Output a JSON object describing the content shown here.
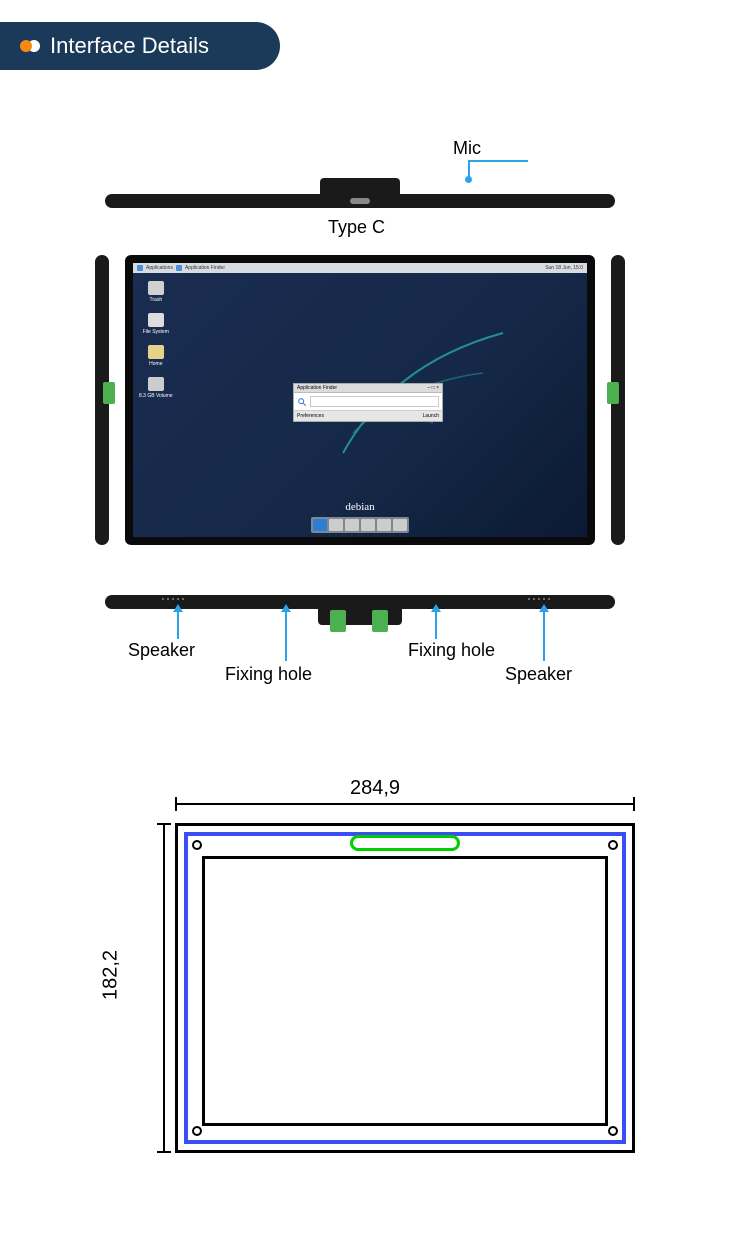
{
  "header": {
    "title": "Interface Details"
  },
  "callouts": {
    "mic": "Mic",
    "typec": "Type C",
    "speaker_left": "Speaker",
    "speaker_right": "Speaker",
    "fixing_left": "Fixing hole",
    "fixing_right": "Fixing hole"
  },
  "screen": {
    "taskbar": {
      "apps": "Applications",
      "finder": "Application Finder",
      "date": "Sun 18 Jun, 15:0"
    },
    "desktop_icons": [
      {
        "label": "Trash"
      },
      {
        "label": "File System"
      },
      {
        "label": "Home"
      },
      {
        "label": "8.3 GB Volume"
      }
    ],
    "window": {
      "title": "Application Finder",
      "close": "– □ ×",
      "prefs": "Preferences",
      "launch": "Launch"
    },
    "os": "debian"
  },
  "dimensions": {
    "width": "284,9",
    "height": "182,2"
  }
}
